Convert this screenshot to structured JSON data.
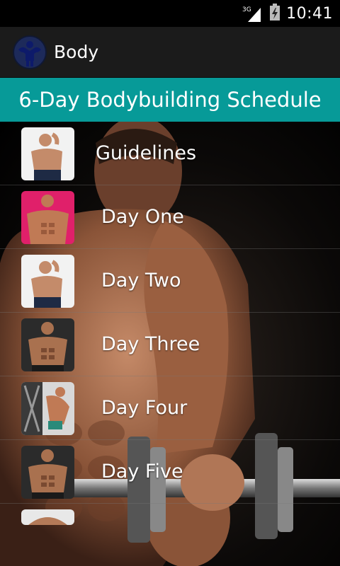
{
  "status_bar": {
    "network": "3G",
    "time": "10:41",
    "icons": [
      "signal-icon",
      "battery-charging-icon"
    ]
  },
  "action_bar": {
    "title": "Body",
    "icon": "bodybuilder-logo-icon"
  },
  "banner": {
    "title": "6-Day Bodybuilding Schedule",
    "color": "#079a98"
  },
  "list": {
    "items": [
      {
        "label": "Guidelines",
        "thumb": "guidelines-thumbnail"
      },
      {
        "label": "Day One",
        "thumb": "day-one-thumbnail"
      },
      {
        "label": "Day Two",
        "thumb": "day-two-thumbnail"
      },
      {
        "label": "Day Three",
        "thumb": "day-three-thumbnail"
      },
      {
        "label": "Day Four",
        "thumb": "day-four-thumbnail"
      },
      {
        "label": "Day Five",
        "thumb": "day-five-thumbnail"
      },
      {
        "label": "",
        "thumb": "day-six-thumbnail"
      }
    ]
  }
}
